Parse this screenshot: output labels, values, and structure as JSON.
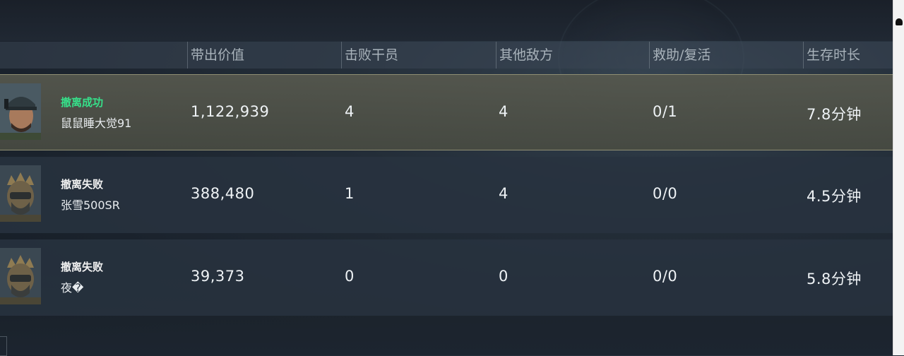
{
  "columns": {
    "value": "带出价值",
    "kills": "击败干员",
    "others": "其他敌方",
    "assist": "救助/复活",
    "time": "生存时长"
  },
  "rows": [
    {
      "status": "撤离成功",
      "name": "鼠鼠睡大觉91",
      "value": "1,122,939",
      "kills": "4",
      "others": "4",
      "assist": "0/1",
      "time": "7.8分钟"
    },
    {
      "status": "撤离失败",
      "name": "张雪500SR",
      "value": "388,480",
      "kills": "1",
      "others": "4",
      "assist": "0/0",
      "time": "4.5分钟"
    },
    {
      "status": "撤离失败",
      "name": "夜�",
      "value": "39,373",
      "kills": "0",
      "others": "0",
      "assist": "0/0",
      "time": "5.8分钟"
    }
  ],
  "colors": {
    "success_status": "#36e08a",
    "fail_status": "#f2f2f2",
    "highlight_border": "#8f8e73"
  },
  "icons": {
    "avatar_1": "soldier-cap-portrait",
    "avatar_2": "armored-helmet-portrait",
    "avatar_3": "armored-helmet-portrait"
  }
}
